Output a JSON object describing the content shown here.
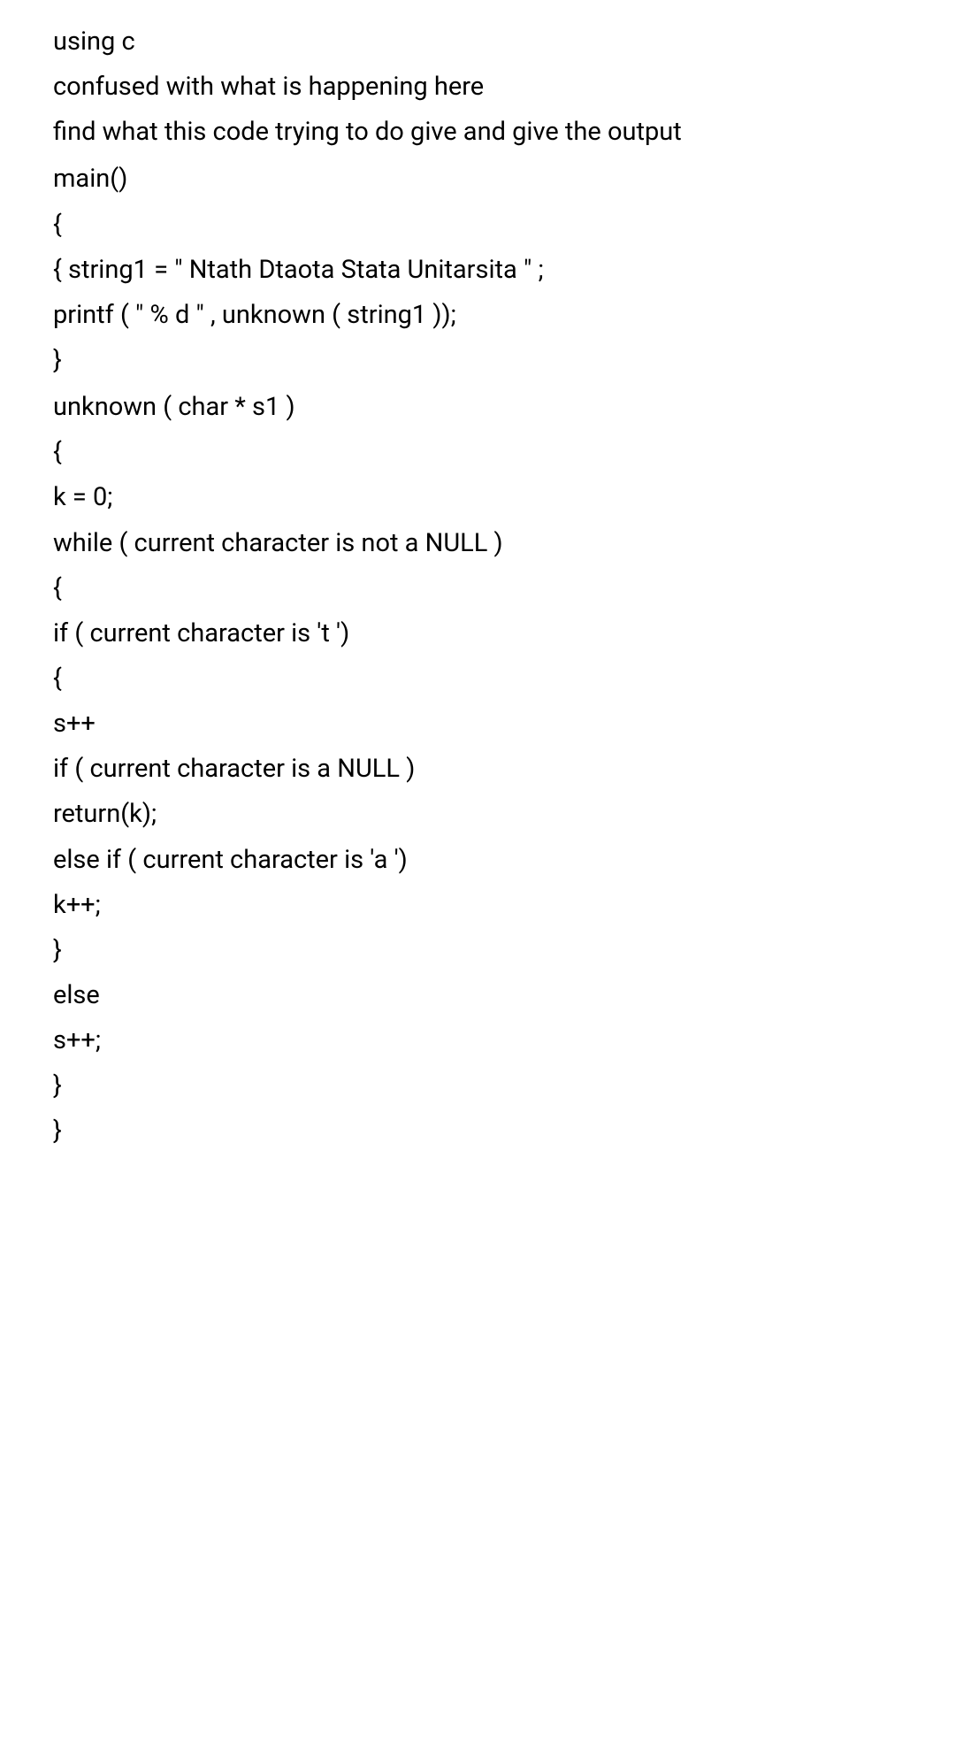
{
  "lines": [
    "using c",
    "confused with what is happening here",
    "find what this code trying to do give and give the output",
    "main()",
    "{",
    "{ string1 = \" Ntath Dtaota Stata Unitarsita \" ;",
    "printf ( \" % d \" , unknown ( string1 ));",
    "}",
    "unknown ( char * s1 )",
    "{",
    "k = 0;",
    "while ( current character is not a NULL )",
    "{",
    "if ( current character is 't ')",
    "{",
    "s++",
    "if ( current character is a NULL )",
    "return(k);",
    "else if ( current character is 'a ')",
    "k++;",
    "}",
    "else",
    "s++;",
    "}",
    "}"
  ]
}
